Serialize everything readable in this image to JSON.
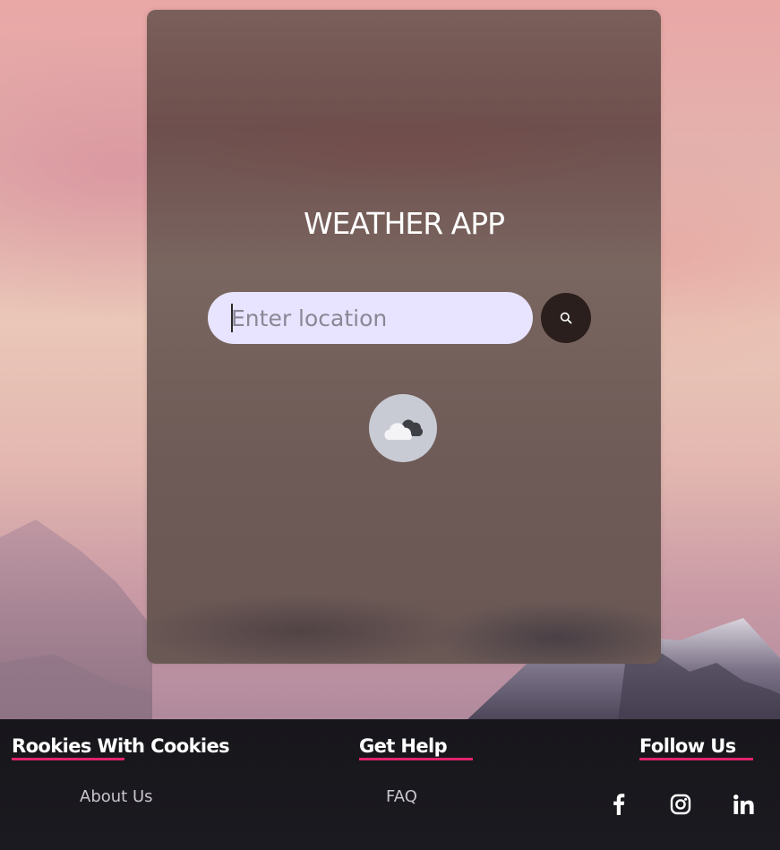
{
  "app": {
    "title": "WEATHER APP"
  },
  "search": {
    "placeholder": "Enter location",
    "value": "",
    "button_icon": "search-icon"
  },
  "weather": {
    "icon": "cloud-icon"
  },
  "footer": {
    "columns": [
      {
        "heading": "Rookies With Cookies",
        "link": "About Us"
      },
      {
        "heading": "Get Help",
        "link": "FAQ"
      },
      {
        "heading": "Follow Us",
        "social": [
          "facebook-icon",
          "instagram-icon",
          "linkedin-icon"
        ]
      }
    ],
    "accent": "#e0246c"
  },
  "colors": {
    "input_bg": "#e8e4ff",
    "search_button": "#2a1f1d",
    "footer_bg": "#17161b"
  }
}
